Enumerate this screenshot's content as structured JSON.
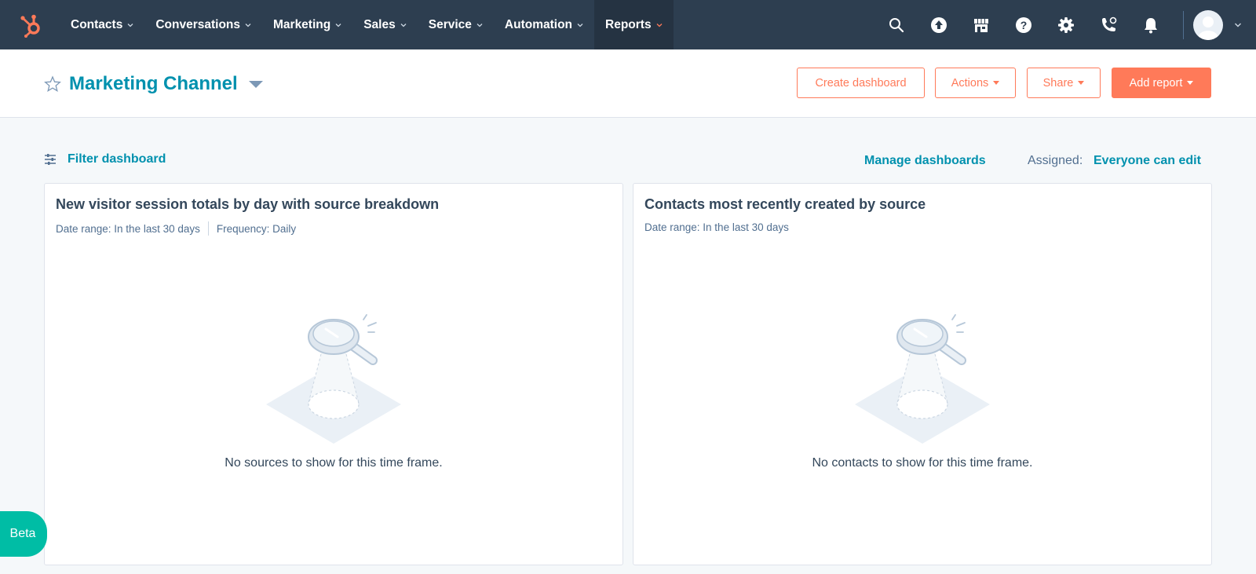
{
  "nav": {
    "items": [
      {
        "label": "Contacts"
      },
      {
        "label": "Conversations"
      },
      {
        "label": "Marketing"
      },
      {
        "label": "Sales"
      },
      {
        "label": "Service"
      },
      {
        "label": "Automation"
      },
      {
        "label": "Reports"
      }
    ],
    "active": "Reports",
    "icons": [
      "search-icon",
      "upgrade-icon",
      "marketplace-icon",
      "help-icon",
      "settings-icon",
      "calling-icon",
      "notifications-icon"
    ]
  },
  "header": {
    "title": "Marketing Channel",
    "buttons": {
      "create_dashboard": "Create dashboard",
      "actions": "Actions",
      "share": "Share",
      "add_report": "Add report"
    }
  },
  "toolbar": {
    "filter_label": "Filter dashboard",
    "manage_label": "Manage dashboards",
    "assigned_label": "Assigned:",
    "assigned_value": "Everyone can edit"
  },
  "reports": [
    {
      "title": "New visitor session totals by day with source breakdown",
      "date_range": "Date range: In the last 30 days",
      "frequency": "Frequency: Daily",
      "empty_message": "No sources to show for this time frame."
    },
    {
      "title": "Contacts most recently created by source",
      "date_range": "Date range: In the last 30 days",
      "empty_message": "No contacts to show for this time frame."
    }
  ],
  "beta_label": "Beta",
  "colors": {
    "nav_bg": "#2d3e50",
    "accent_orange": "#ff7a59",
    "link_teal": "#0091ae",
    "beta_green": "#00bda5"
  }
}
